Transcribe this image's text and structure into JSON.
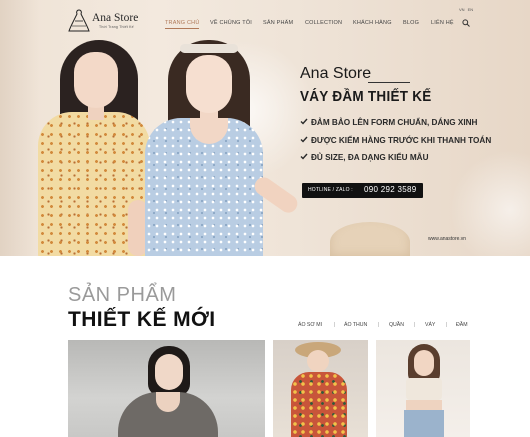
{
  "brand": {
    "name": "Ana Store",
    "tagline": "Thời Trang Thiết Kế"
  },
  "language": {
    "options": [
      "VN",
      "EN"
    ]
  },
  "nav": {
    "items": [
      "TRANG CHỦ",
      "VỀ CHÚNG TÔI",
      "SẢN PHẨM",
      "COLLECTION",
      "KHÁCH HÀNG",
      "BLOG",
      "LIÊN HỆ"
    ],
    "active": "TRANG CHỦ"
  },
  "hero": {
    "brand": "Ana Store",
    "headline": "VÁY ĐẦM THIẾT KẾ",
    "bullets": [
      "ĐẢM BẢO LÊN FORM CHUẨN, DÁNG XINH",
      "ĐƯỢC KIỂM HÀNG TRƯỚC KHI THANH TOÁN",
      "ĐỦ SIZE, ĐA DẠNG KIỂU MẪU"
    ],
    "hotline_label": "HOTLINE / ZALO :",
    "hotline_number": "090 292 3589",
    "website": "www.anastore.vn"
  },
  "products": {
    "subtitle": "SẢN PHẨM",
    "title": "THIẾT KẾ MỚI",
    "filters": [
      "ÁO SƠ MI",
      "ÁO THUN",
      "QUẦN",
      "VÁY",
      "ĐẦM"
    ]
  },
  "icons": {
    "logo": "dress-logo-icon",
    "search": "search-icon",
    "bullet": "check-icon"
  },
  "colors": {
    "accent": "#b07a5a",
    "hotline_bg": "#111111",
    "text_dark": "#1a1a1a",
    "subtitle_gray": "#9a9a9a"
  }
}
